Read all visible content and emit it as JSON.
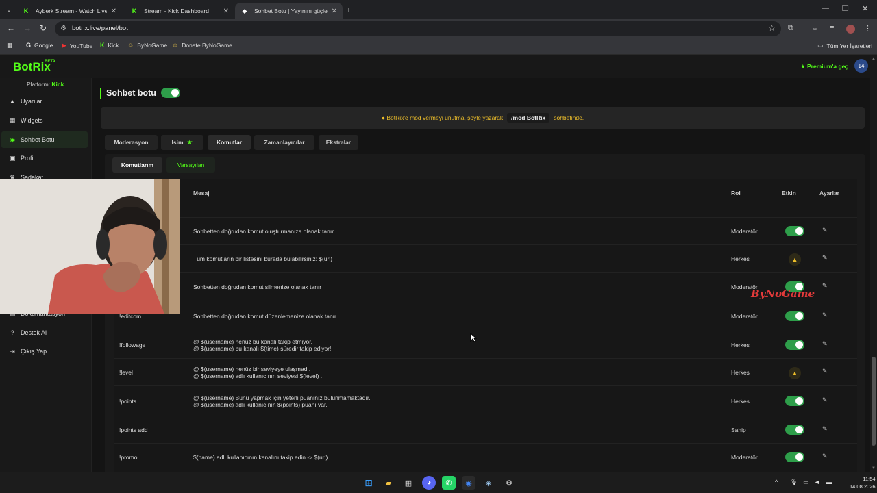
{
  "browser": {
    "tabs": [
      {
        "title": "Ayberk Stream - Watch Live on",
        "favicon": "kick-icon"
      },
      {
        "title": "Stream - Kick Dashboard",
        "favicon": "kick-icon"
      },
      {
        "title": "Sohbet Botu | Yayınını güçlendi",
        "favicon": "botrix-icon"
      }
    ],
    "url": "botrix.live/panel/bot",
    "bookmarks": [
      "Google",
      "YouTube",
      "Kick",
      "ByNoGame",
      "Donate ByNoGame"
    ],
    "all_bookmarks_label": "Tüm Yer İşaretleri"
  },
  "app": {
    "logo": "BotRix",
    "beta": "BETA",
    "premium_label": "Premium'a geç",
    "brand_color": "#53fc18"
  },
  "sidebar": {
    "platform_label": "Platform:",
    "platform_value": "Kick",
    "items": [
      {
        "label": "Uyarılar",
        "icon": "warning-icon"
      },
      {
        "label": "Widgets",
        "icon": "widgets-icon"
      },
      {
        "label": "Sohbet Botu",
        "icon": "robot-icon"
      },
      {
        "label": "Profil",
        "icon": "profile-icon"
      },
      {
        "label": "Sadakat",
        "icon": "trophy-icon"
      },
      {
        "label": "Dokümantasyon",
        "icon": "docs-icon"
      },
      {
        "label": "Destek Al",
        "icon": "help-icon"
      },
      {
        "label": "Çıkış Yap",
        "icon": "logout-icon"
      }
    ]
  },
  "main": {
    "title": "Sohbet botu",
    "notice": {
      "before": "BotRix'e mod vermeyi unutma, şöyle yazarak",
      "command": "/mod BotRix",
      "after": "sohbetinde."
    },
    "tabs": [
      "Moderasyon",
      "İsim",
      "Komutlar",
      "Zamanlayıcılar",
      "Ekstralar"
    ],
    "subtabs": [
      "Komutlarım",
      "Varsayılan"
    ],
    "columns": {
      "message": "Mesaj",
      "role": "Rol",
      "active": "Etkin",
      "settings": "Ayarlar"
    },
    "rows": [
      {
        "name": "",
        "message": [
          "Sohbetten doğrudan komut oluşturmanıza olanak tanır"
        ],
        "role": "Moderatör",
        "active": "toggle"
      },
      {
        "name": "",
        "message": [
          "Tüm komutların bir listesini burada bulabilirsiniz: $(url)"
        ],
        "role": "Herkes",
        "active": "warning"
      },
      {
        "name": "",
        "message": [
          "Sohbetten doğrudan komut silmenize olanak tanır"
        ],
        "role": "Moderatör",
        "active": "toggle"
      },
      {
        "name": "!editcom",
        "message": [
          "Sohbetten doğrudan komut düzenlemenize olanak tanır"
        ],
        "role": "Moderatör",
        "active": "toggle"
      },
      {
        "name": "!followage",
        "message": [
          "@ $(username) henüz bu kanalı takip etmiyor.",
          "@ $(username) bu kanalı $(time) süredir takip ediyor!"
        ],
        "role": "Herkes",
        "active": "toggle"
      },
      {
        "name": "!level",
        "message": [
          "@ $(username) henüz bir seviyeye ulaşmadı.",
          "@ $(username) adlı kullanıcının seviyesi $(level) ."
        ],
        "role": "Herkes",
        "active": "warning"
      },
      {
        "name": "!points",
        "message": [
          "@ $(username) Bunu yapmak için yeterli puanınız bulunmamaktadır.",
          "@ $(username) adlı kullanıcının $(points) puanı var."
        ],
        "role": "Herkes",
        "active": "toggle"
      },
      {
        "name": "!points add",
        "message": [
          ""
        ],
        "role": "Sahip",
        "active": "toggle"
      },
      {
        "name": "!promo",
        "message": [
          "$(name) adlı kullanıcının kanalını takip edin -> $(url)"
        ],
        "role": "Moderatör",
        "active": "toggle"
      }
    ]
  },
  "overlay": {
    "watermark": "ByNoGame"
  },
  "taskbar": {
    "time": "11:54",
    "date": "14.08.2026"
  }
}
